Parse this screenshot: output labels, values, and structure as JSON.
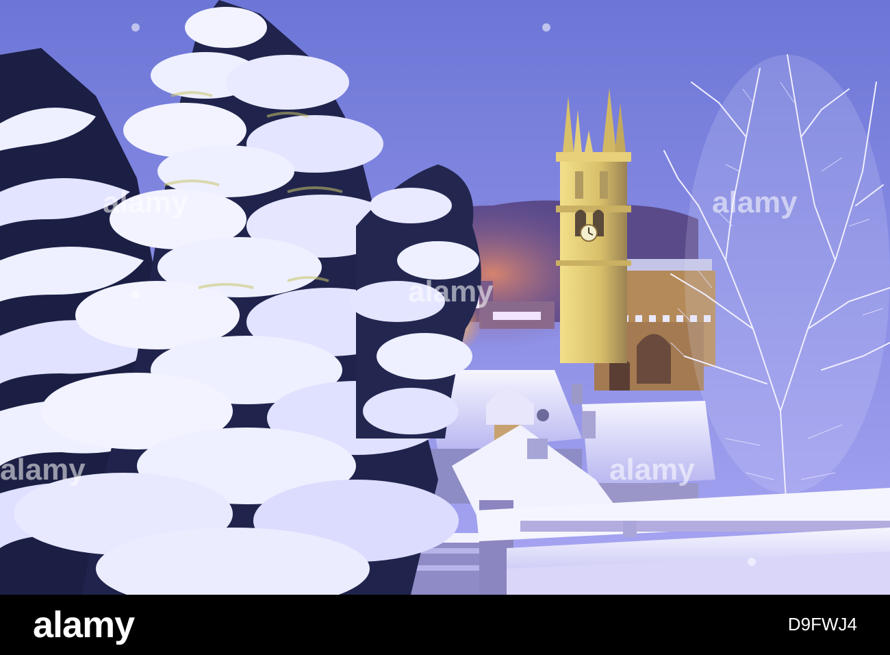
{
  "photo": {
    "colors": {
      "sky_top": "#6f78d8",
      "sky_bottom": "#a6a4f2",
      "snow": "#eef0ff",
      "snow_shadow": "#8c8ce0",
      "stone_lit": "#d8c070",
      "lamp_glow": "#ffb347",
      "tree_dark": "#1c1f44"
    }
  },
  "watermark": {
    "text": "alamy"
  },
  "footer": {
    "logo": "alamy",
    "image_code": "D9FWJ4"
  }
}
